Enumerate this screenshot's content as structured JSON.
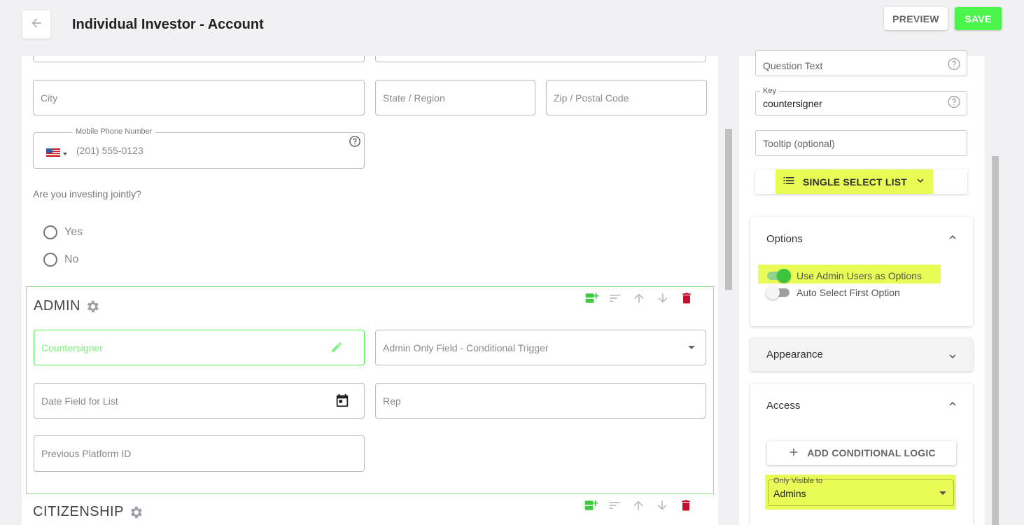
{
  "header": {
    "title": "Individual Investor - Account",
    "preview_label": "PREVIEW",
    "save_label": "SAVE",
    "colors": {
      "save": "#4cf54c",
      "highlight": "#e9fb55"
    }
  },
  "form": {
    "city_placeholder": "City",
    "state_placeholder": "State / Region",
    "zip_placeholder": "Zip / Postal Code",
    "phone": {
      "label": "Mobile Phone Number",
      "placeholder": "(201) 555-0123",
      "country_flag": "us-flag-icon"
    },
    "joint_question": "Are you investing jointly?",
    "joint_options": [
      "Yes",
      "No"
    ]
  },
  "admin_section": {
    "title": "ADMIN",
    "fields": {
      "countersigner": "Countersigner",
      "conditional_trigger": "Admin Only Field - Conditional Trigger",
      "date_field": "Date Field for List",
      "rep": "Rep",
      "previous_platform_id": "Previous Platform ID"
    }
  },
  "citizenship_section": {
    "title": "CITIZENSHIP"
  },
  "settings": {
    "question_text_placeholder": "Question Text",
    "key_label": "Key",
    "key_value": "countersigner",
    "tooltip_placeholder": "Tooltip (optional)",
    "field_type_label": "SINGLE SELECT LIST",
    "options": {
      "title": "Options",
      "use_admin_users_label": "Use Admin Users as Options",
      "use_admin_users_on": true,
      "auto_select_first_label": "Auto Select First Option",
      "auto_select_first_on": false
    },
    "appearance": {
      "title": "Appearance"
    },
    "access": {
      "title": "Access",
      "add_conditional_label": "ADD CONDITIONAL LOGIC",
      "visible_to_label": "Only Visible to",
      "visible_to_value": "Admins"
    }
  }
}
